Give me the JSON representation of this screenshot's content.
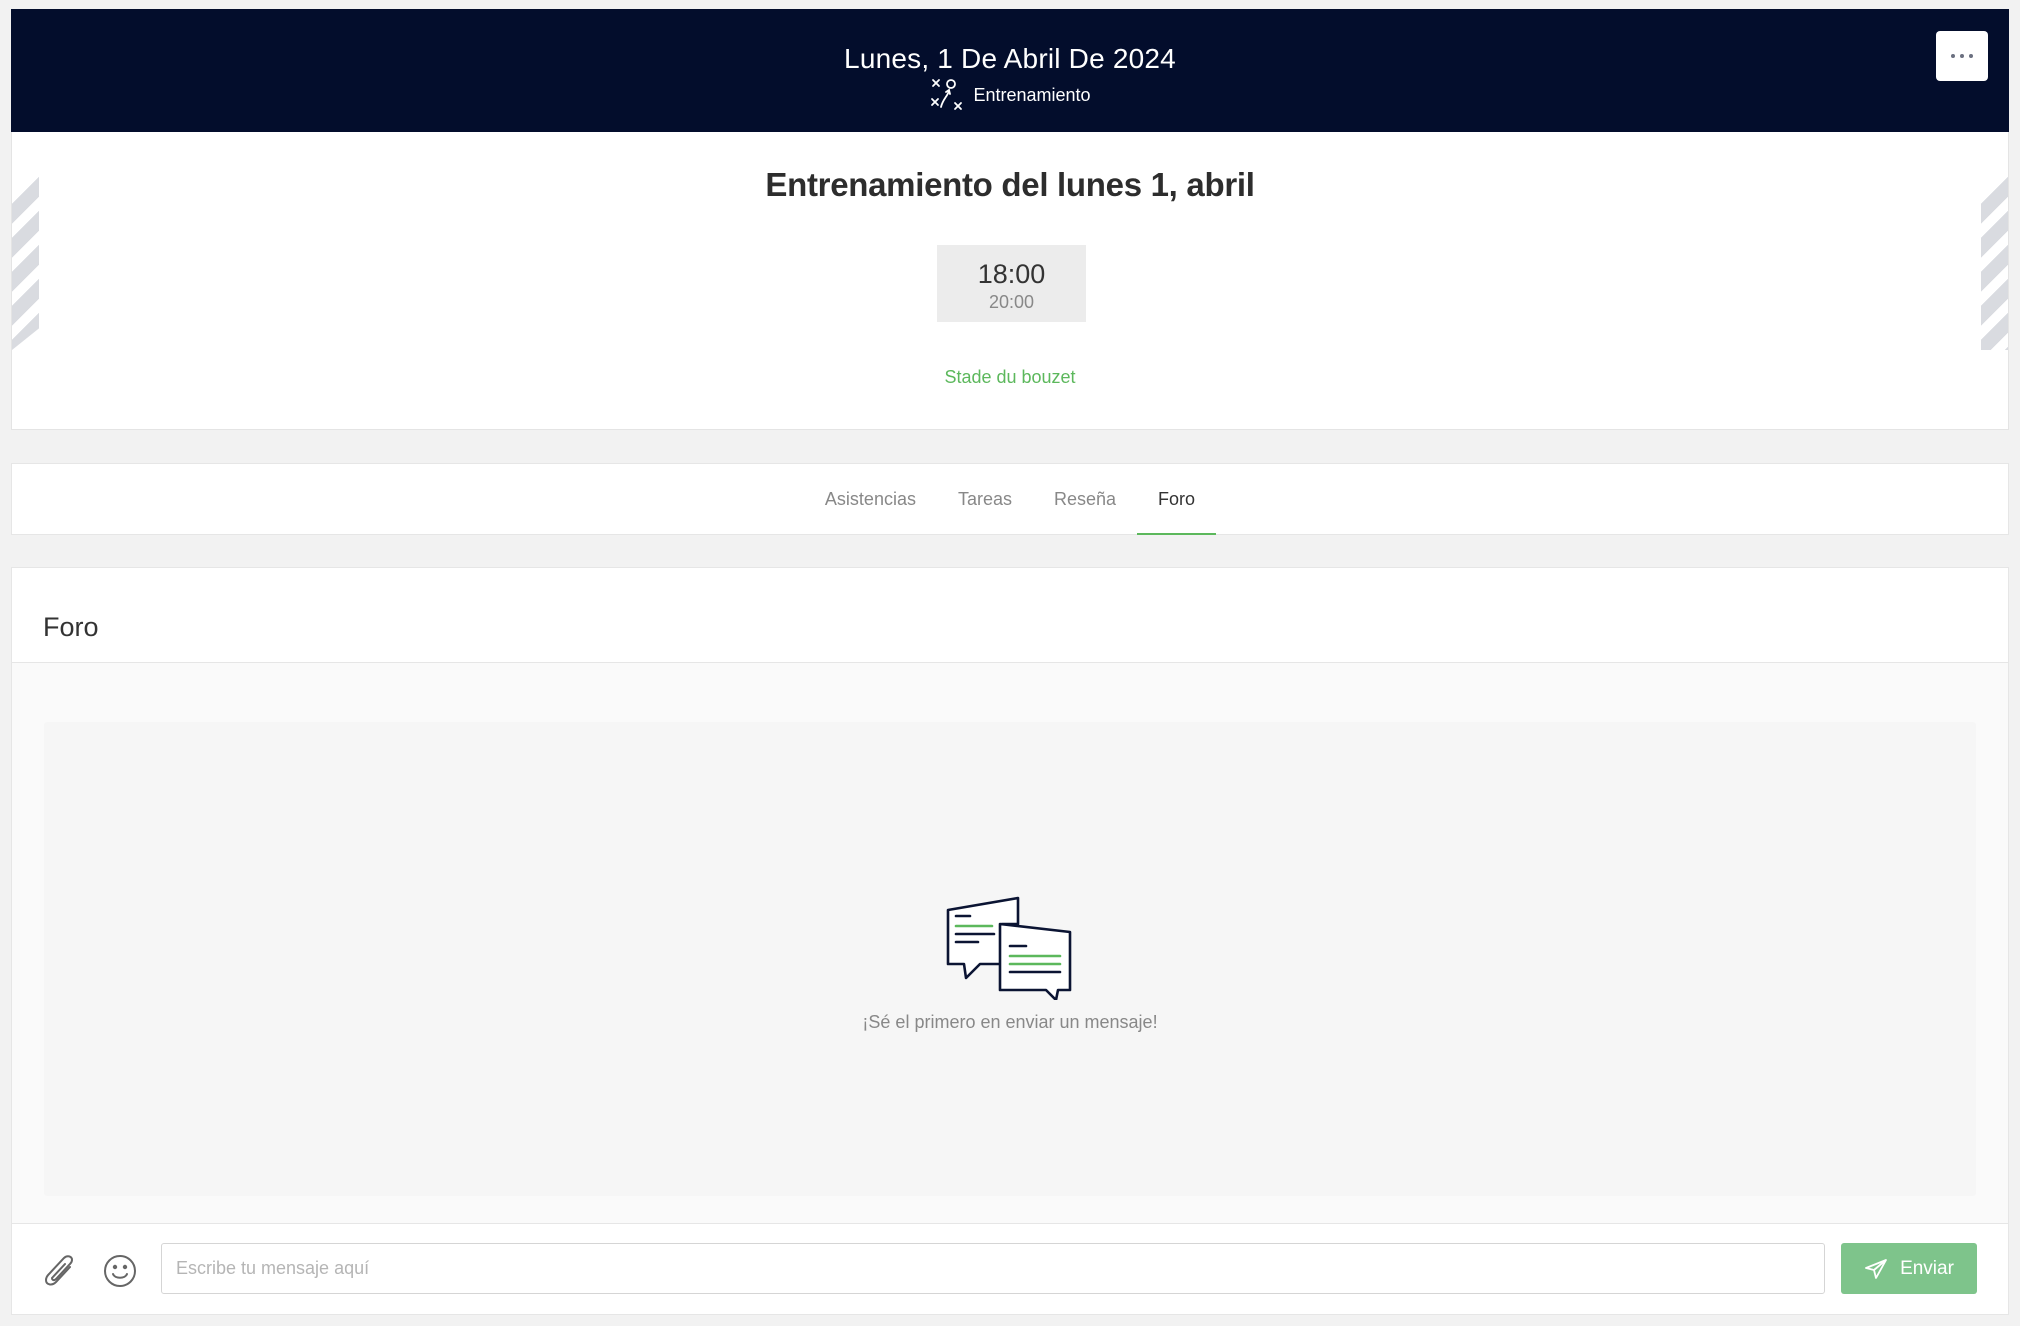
{
  "header": {
    "date": "Lunes, 1 De Abril De 2024",
    "event_type": "Entrenamiento",
    "event_type_icon": "tactics-board-icon",
    "more_icon": "ellipsis-icon"
  },
  "event": {
    "title": "Entrenamiento del lunes 1, abril",
    "start_time": "18:00",
    "end_time": "20:00",
    "venue": "Stade du bouzet"
  },
  "tabs": [
    {
      "label": "Asistencias",
      "active": false
    },
    {
      "label": "Tareas",
      "active": false
    },
    {
      "label": "Reseña",
      "active": false
    },
    {
      "label": "Foro",
      "active": true
    }
  ],
  "forum": {
    "heading": "Foro",
    "empty_icon": "chat-bubbles-icon",
    "empty_message": "¡Sé el primero en enviar un mensaje!",
    "composer": {
      "attach_icon": "paperclip-icon",
      "emoji_icon": "smiley-icon",
      "placeholder": "Escribe tu mensaje aquí",
      "value": "",
      "send_label": "Enviar",
      "send_icon": "paper-plane-icon"
    }
  },
  "colors": {
    "header_bg": "#030d2c",
    "accent": "#5cb85c",
    "send_button": "#7ec48b"
  }
}
